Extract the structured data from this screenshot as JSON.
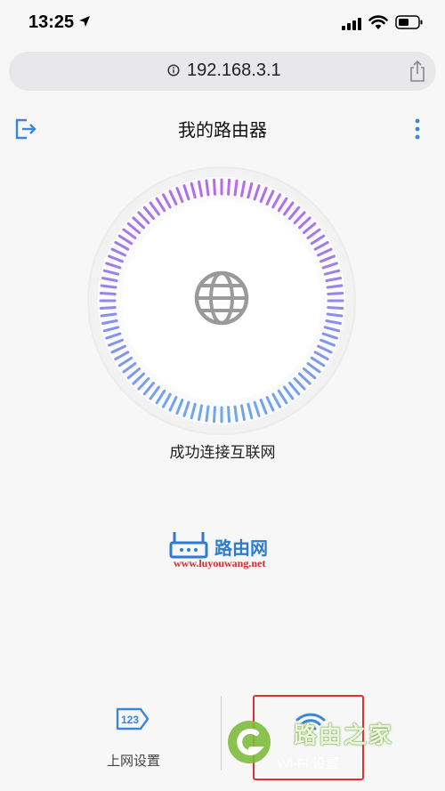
{
  "status_bar": {
    "time": "13:25"
  },
  "url_bar": {
    "url": "192.168.3.1"
  },
  "header": {
    "title": "我的路由器"
  },
  "main": {
    "status_text": "成功连接互联网"
  },
  "watermark": {
    "brand_cn": "路由网",
    "site_url": "www.luyouwang.net",
    "bottom_brand": "路由之家"
  },
  "bottom_nav": {
    "items": [
      {
        "label": "上网设置",
        "icon": "123-icon"
      },
      {
        "label": "Wi-Fi 设置",
        "icon": "wifi-icon"
      }
    ]
  },
  "colors": {
    "accent_blue": "#3a86d8",
    "dial_gradient_start": "#b46ce8",
    "dial_gradient_end": "#6fa6ee",
    "highlight_red": "#e03030"
  }
}
